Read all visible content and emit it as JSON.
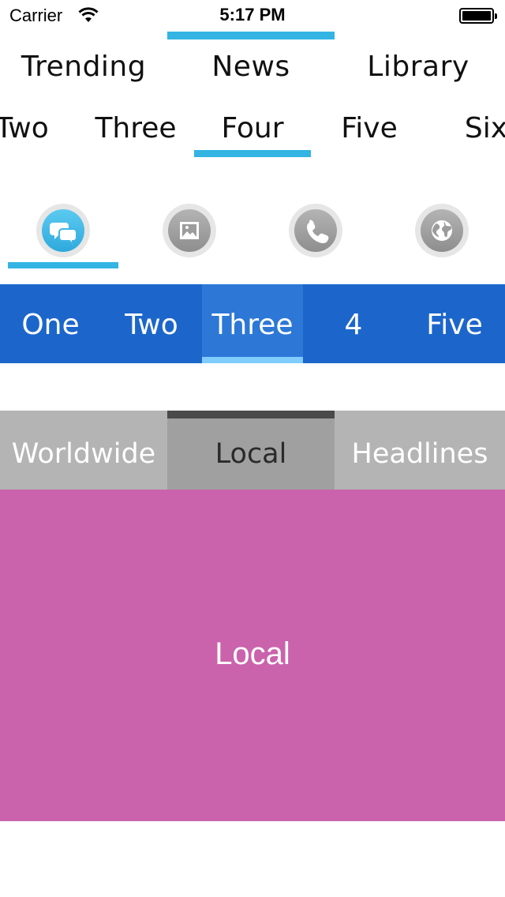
{
  "status_bar": {
    "carrier": "Carrier",
    "time": "5:17 PM"
  },
  "top_tabs": {
    "items": [
      "Trending",
      "News",
      "Library"
    ],
    "selected": "News"
  },
  "scroll_tabs": {
    "items": [
      "Two",
      "Three",
      "Four",
      "Five",
      "Six"
    ],
    "selected": "Four"
  },
  "icon_tabs": {
    "items": [
      "chat-bubbles-icon",
      "picture-icon",
      "phone-icon",
      "globe-icon"
    ],
    "selected": "chat-bubbles-icon"
  },
  "blue_tabs": {
    "items": [
      "One",
      "Two",
      "Three",
      "4",
      "Five"
    ],
    "selected": "Three"
  },
  "gray_tabs": {
    "items": [
      "Worldwide",
      "Local",
      "Headlines"
    ],
    "selected": "Local"
  },
  "content": {
    "label": "Local"
  },
  "colors": {
    "accent_blue": "#33b4e3",
    "blue_bar": "#1c66cb",
    "blue_bar_active": "#2d78d7",
    "blue_bar_indicator": "#80ccff",
    "gray_bar": "#b4b4b4",
    "gray_bar_active": "#a0a0a0",
    "gray_bar_indicator": "#4a4a4a",
    "content_background": "#ca63ac"
  }
}
